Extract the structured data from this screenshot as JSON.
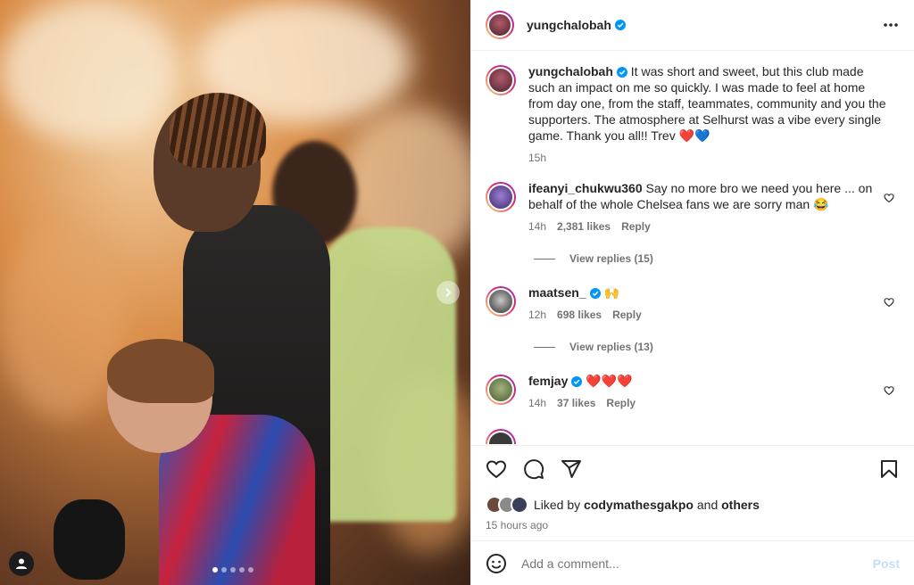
{
  "post": {
    "author": "yungchalobah",
    "caption": "It was short and sweet, but this club made such an impact on me so quickly. I was made to feel at home from day one, from the staff, teammates, community and you the supporters. The atmosphere at Selhurst was a vibe every single game. Thank you all!! Trev ❤️💙",
    "time": "15h",
    "liked_by_prefix": "Liked by",
    "liked_by_user": "codymathesgakpo",
    "liked_by_and": "and",
    "liked_by_others": "others",
    "posted_ago": "15 hours ago"
  },
  "comments": [
    {
      "user": "ifeanyi_chukwu360",
      "text": "Say no more bro we need you here ... on behalf of the whole Chelsea fans we are sorry man 😂",
      "time": "14h",
      "likes": "2,381 likes",
      "reply": "Reply",
      "view_replies": "View replies (15)"
    },
    {
      "user": "maatsen_",
      "text": "🙌",
      "time": "12h",
      "likes": "698 likes",
      "reply": "Reply",
      "view_replies": "View replies (13)"
    },
    {
      "user": "femjay",
      "text": "❤️❤️❤️",
      "time": "14h",
      "likes": "37 likes",
      "reply": "Reply"
    }
  ],
  "add_comment": {
    "placeholder": "Add a comment...",
    "post_label": "Post"
  },
  "carousel": {
    "slides": 5,
    "active_slide": 1
  },
  "colors": {
    "verified": "#0095f6",
    "meta_text": "#737373",
    "post_disabled": "#c0dffd"
  }
}
